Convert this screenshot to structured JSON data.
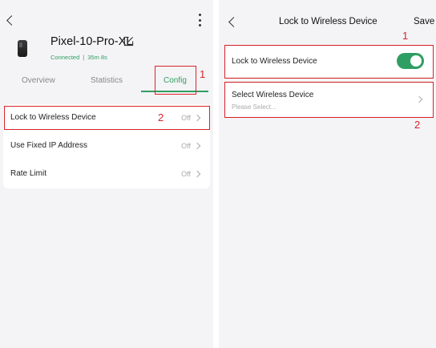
{
  "left": {
    "device_name": "Pixel-10-Pro-XL",
    "status": "Connected",
    "status_sep": "|",
    "duration": "35m 8s",
    "tabs": {
      "overview": "Overview",
      "statistics": "Statistics",
      "config": "Config"
    },
    "active_tab": "config",
    "rows": [
      {
        "label": "Lock to Wireless Device",
        "value": "Off"
      },
      {
        "label": "Use Fixed IP Address",
        "value": "Off"
      },
      {
        "label": "Rate Limit",
        "value": "Off"
      }
    ]
  },
  "right": {
    "title": "Lock to Wireless Device",
    "save_label": "Save",
    "lock_label": "Lock to Wireless Device",
    "lock_enabled": true,
    "select_label": "Select Wireless Device",
    "select_placeholder": "Please Select..."
  },
  "annotations": {
    "left": [
      "1",
      "2"
    ],
    "right": [
      "1",
      "2"
    ]
  },
  "colors": {
    "accent": "#2f9e62",
    "annotation": "#d8232a",
    "background": "#f4f4f6",
    "card": "#ffffff"
  },
  "icons": {
    "back": "chevron-left-icon",
    "more": "more-vertical-icon",
    "device": "phone-icon",
    "edit": "edit-icon",
    "row_arrow": "chevron-right-icon"
  }
}
